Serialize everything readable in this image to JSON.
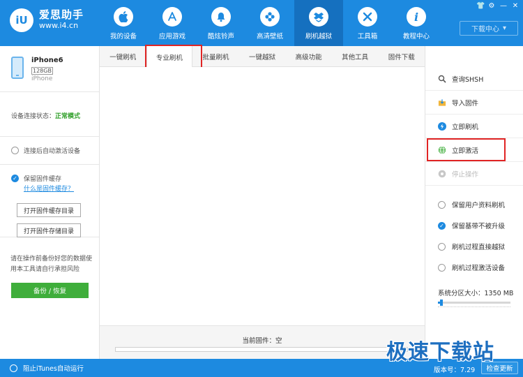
{
  "app": {
    "logo_mark": "iU",
    "name": "爱思助手",
    "url": "www.i4.cn"
  },
  "nav": [
    {
      "label": "我的设备",
      "icon": "apple-icon",
      "glyph": ""
    },
    {
      "label": "应用游戏",
      "icon": "app-store-icon",
      "glyph": "A"
    },
    {
      "label": "酷炫铃声",
      "icon": "bell-icon",
      "glyph": "🔔"
    },
    {
      "label": "高清壁纸",
      "icon": "flower-icon",
      "glyph": "✿"
    },
    {
      "label": "刷机越狱",
      "icon": "dropbox-icon",
      "glyph": "◈"
    },
    {
      "label": "工具箱",
      "icon": "tools-icon",
      "glyph": "✕"
    },
    {
      "label": "教程中心",
      "icon": "info-icon",
      "glyph": "i"
    }
  ],
  "window_controls": [
    "👕",
    "⚙",
    "—",
    "✕"
  ],
  "download_center": "下载中心",
  "device": {
    "name": "iPhone6",
    "capacity": "128GB",
    "type": "iPhone"
  },
  "connection": {
    "label": "设备连接状态：",
    "value": "正常模式"
  },
  "auto_activate": "连接后自动激活设备",
  "firmware_cache": {
    "label": "保留固件缓存",
    "link": "什么是固件缓存？",
    "open_cache_btn": "打开固件缓存目录",
    "open_store_btn": "打开固件存储目录"
  },
  "warning_text": "请在操作前备份好您的数据使用本工具请自行承担风险",
  "backup_btn": "备份 / 恢复",
  "tabs": [
    {
      "label": "一键刷机"
    },
    {
      "label": "专业刷机"
    },
    {
      "label": "批量刷机"
    },
    {
      "label": "一键越狱"
    },
    {
      "label": "高级功能"
    },
    {
      "label": "其他工具"
    },
    {
      "label": "固件下载"
    }
  ],
  "current_firmware": "当前固件：空",
  "actions": {
    "query_shsh": "查询SHSH",
    "import_firmware": "导入固件",
    "flash_now": "立即刷机",
    "activate_now": "立即激活",
    "stop": "停止操作"
  },
  "options": [
    {
      "label": "保留用户资料刷机",
      "checked": false
    },
    {
      "label": "保留基带不被升级",
      "checked": true
    },
    {
      "label": "刷机过程直接越狱",
      "checked": false
    },
    {
      "label": "刷机过程激活设备",
      "checked": false
    }
  ],
  "partition": {
    "label": "系统分区大小：1350 MB",
    "slider_fraction": 0.04
  },
  "status_bar": {
    "itunes": "阻止iTunes自动运行",
    "version": "版本号：7.29",
    "update_btn": "检查更新"
  },
  "watermark": "极速下载站",
  "colors": {
    "brand_blue": "#1d8ae0",
    "active_nav": "#1570bf",
    "green": "#3fae3b",
    "highlight_red": "#e02424"
  }
}
